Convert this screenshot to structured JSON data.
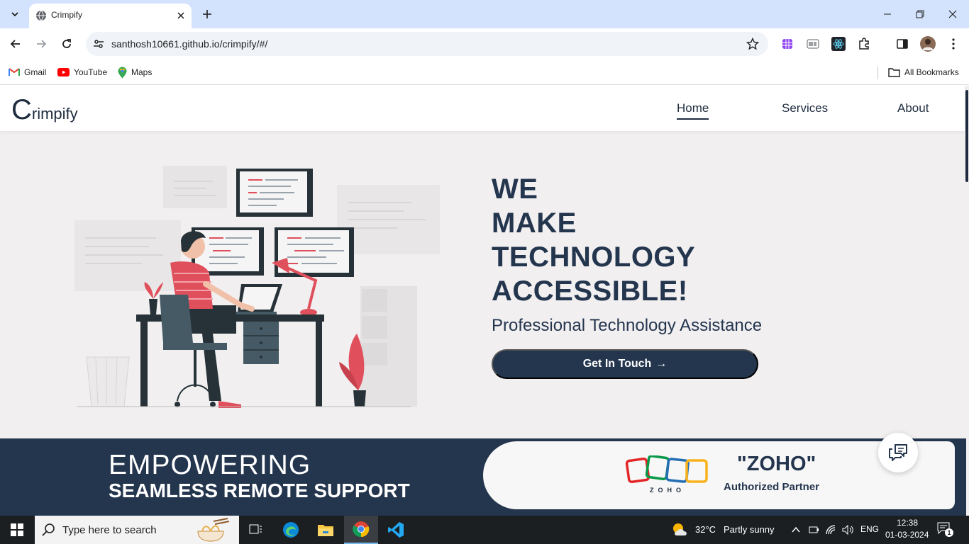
{
  "browser": {
    "tab_title": "Crimpify",
    "url": "santhosh10661.github.io/crimpify/#/",
    "bookmarks": [
      {
        "label": "Gmail",
        "icon": "gmail-icon"
      },
      {
        "label": "YouTube",
        "icon": "youtube-icon"
      },
      {
        "label": "Maps",
        "icon": "maps-icon"
      }
    ],
    "all_bookmarks_label": "All Bookmarks"
  },
  "site": {
    "logo_initial": "C",
    "logo_rest": "rimpify",
    "nav": [
      {
        "label": "Home",
        "active": true
      },
      {
        "label": "Services",
        "active": false
      },
      {
        "label": "About",
        "active": false
      }
    ],
    "hero": {
      "headline_lines": [
        "WE",
        "MAKE",
        "TECHNOLOGY",
        "ACCESSIBLE!"
      ],
      "subline": "Professional Technology Assistance",
      "cta_label": "Get In Touch",
      "cta_arrow": "→"
    },
    "band": {
      "title": "EMPOWERING",
      "subtitle": "SEAMLESS REMOTE SUPPORT",
      "partner_name": "\"ZOHO\"",
      "partner_tag": "Authorized Partner",
      "partner_logo_text": "ZOHO"
    }
  },
  "taskbar": {
    "search_placeholder": "Type here to search",
    "weather_temp": "32°C",
    "weather_desc": "Partly sunny",
    "language": "ENG",
    "time": "12:38",
    "date": "01-03-2024",
    "notification_count": "1"
  },
  "colors": {
    "brand_navy": "#24354e",
    "accent_red": "#e0505c",
    "page_bg": "#f1eff0",
    "tab_strip": "#d3e3fd"
  }
}
